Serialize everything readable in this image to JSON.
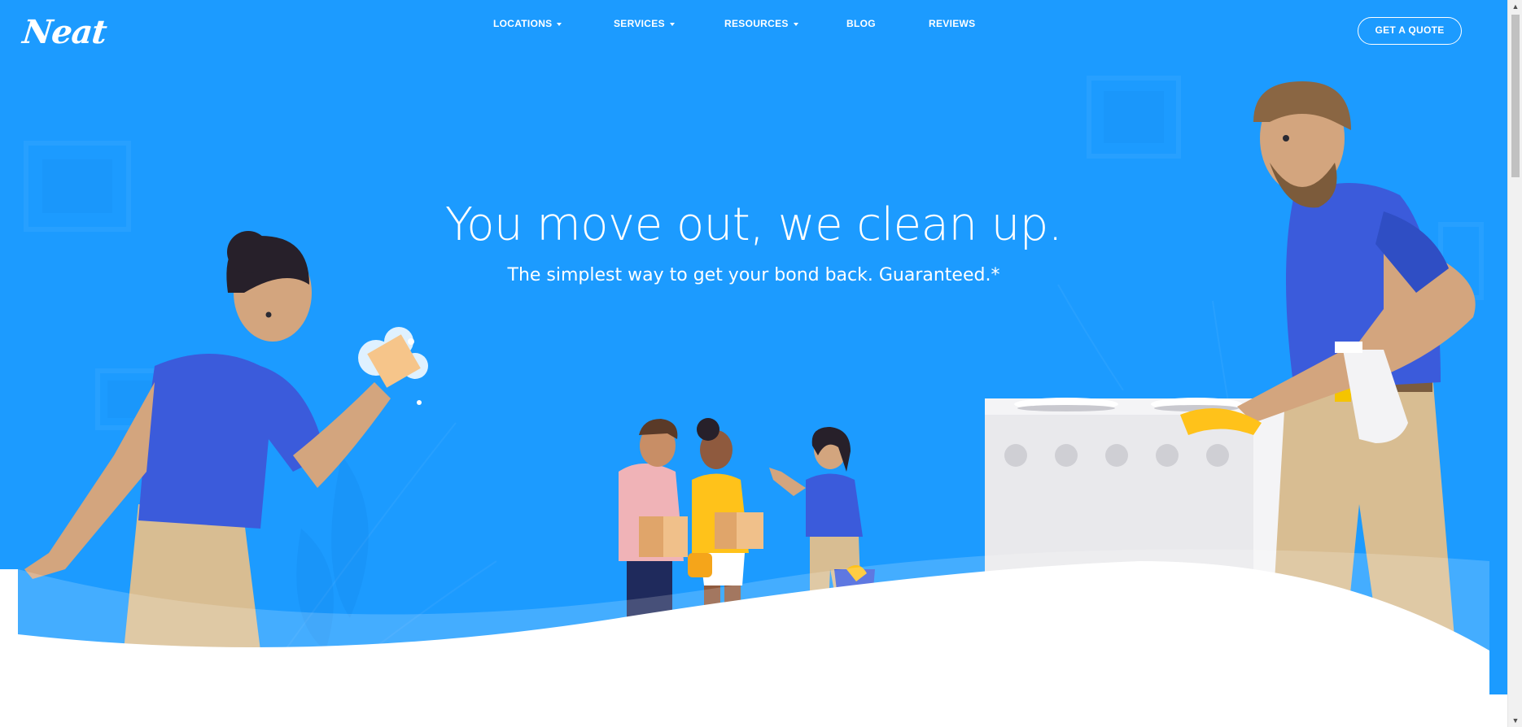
{
  "brand": {
    "logo_text": "Neat",
    "primary_color": "#1c9bff",
    "accent_color": "#3b5bdb"
  },
  "nav": {
    "items": [
      {
        "label": "LOCATIONS",
        "has_dropdown": true
      },
      {
        "label": "SERVICES",
        "has_dropdown": true
      },
      {
        "label": "RESOURCES",
        "has_dropdown": true
      },
      {
        "label": "BLOG",
        "has_dropdown": false
      },
      {
        "label": "REVIEWS",
        "has_dropdown": false
      }
    ],
    "cta_label": "GET A QUOTE"
  },
  "hero": {
    "headline": "You move out, we clean up.",
    "subheadline": "The simplest way to get your bond back. Guaranteed.*"
  },
  "icons": {
    "scroll_up": "chevron-up-icon",
    "scroll_down": "chevron-down-icon",
    "dropdown": "caret-down-icon"
  }
}
